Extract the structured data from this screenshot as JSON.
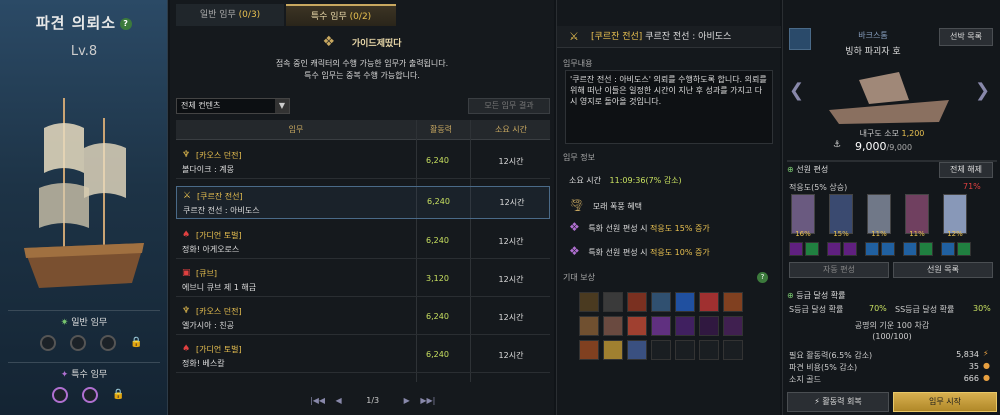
{
  "left": {
    "title": "파견 의뢰소",
    "help": "?",
    "level": "Lv.8",
    "normal_mission_label": "일반 임무",
    "special_mission_label": "특수 임무"
  },
  "tabs": [
    {
      "label": "일반 임무",
      "count": "(0/3)"
    },
    {
      "label": "특수 임무",
      "count": "(0/2)"
    }
  ],
  "guide": {
    "title": "가이드제띴다",
    "line1": "접속 중인 캐릭터의 수행 가능한 임무가 출력됩니다.",
    "line2": "특수 임무는 중복 수행 가능합니다."
  },
  "filter": {
    "value": "전체 컨텐츠",
    "result_button": "모든 임무 결과"
  },
  "table": {
    "headers": {
      "mission": "임무",
      "activity": "활동력",
      "time": "소요 시간"
    },
    "rows": [
      {
        "category": "[카오스 던전]",
        "name": "볼다이크 : 계몽",
        "activity": "6,240",
        "time": "12시간"
      },
      {
        "category": "[쿠르잔 전선]",
        "name": "쿠르잔 전선 : 아비도스",
        "activity": "6,240",
        "time": "12시간"
      },
      {
        "category": "[가디언 토벌]",
        "name": "정화! 아게오로스",
        "activity": "6,240",
        "time": "12시간"
      },
      {
        "category": "[큐브]",
        "name": "에브니 큐브 제 1 해금",
        "activity": "3,120",
        "time": "12시간"
      },
      {
        "category": "[카오스 던전]",
        "name": "엘가시아 : 친공",
        "activity": "6,240",
        "time": "12시간"
      },
      {
        "category": "[가디언 토벌]",
        "name": "정화! 베스칼",
        "activity": "6,240",
        "time": "12시간"
      }
    ]
  },
  "pager": {
    "current": "1/3"
  },
  "detail": {
    "header_tag": "[쿠르잔 전선]",
    "header_name": "쿠르잔 전선 : 아비도스",
    "content_label": "임무내용",
    "content_text": "'쿠르잔 전선 : 아비도스' 의뢰를 수행하도록 합니다. 의뢰를 위해 떠난 이들은 일정한 시간이 지난 후 성과를 가지고 다시 영지로 돌아올 것입니다.",
    "info_label": "임무 정보",
    "time_label": "소요 시간",
    "time_value": "11:09:36(7% 감소)",
    "benefit1": "모래 폭풍 혜택",
    "benefit2_pre": "특화 선원 편성 시",
    "benefit2_val": "적응도 15% 증가",
    "benefit3_pre": "특화 선원 편성 시",
    "benefit3_val": "적응도 10% 증가",
    "reward_label": "기대 보상",
    "reward_help": "?"
  },
  "ship": {
    "type": "바크스톰",
    "name": "빙하 파괴자 호",
    "select_button": "선박 목록",
    "durability_label": "내구도 소모",
    "durability_value": "1,200",
    "hp_current": "9,000",
    "hp_max": "/9,000"
  },
  "crew": {
    "label": "선원 편성",
    "disband_button": "전체 해제",
    "adapt_label": "적응도(5% 상승)",
    "adapt_value": "71%",
    "members": [
      {
        "pct": "16%",
        "color": "#6a5a80"
      },
      {
        "pct": "15%",
        "color": "#3a4a70"
      },
      {
        "pct": "11%",
        "color": "#707888"
      },
      {
        "pct": "11%",
        "color": "#704060"
      },
      {
        "pct": "12%",
        "color": "#8898b8"
      }
    ],
    "auto_button": "자동 편성",
    "list_button": "선원 목록"
  },
  "grade": {
    "label": "등급 달성 확률",
    "s_label": "S등급 달성 확률",
    "s_value": "70%",
    "ss_label": "SS등급 달성 확률",
    "ss_value": "30%",
    "honor_line1": "공명의 기운 100 차감",
    "honor_line2": "(100/100)"
  },
  "cost": {
    "activity_label": "필요 활동력(6.5% 감소)",
    "activity_value": "5,834",
    "dispatch_label": "파견 비용(5% 감소)",
    "dispatch_value": "35",
    "gold_label": "소지 골드",
    "gold_value": "666"
  },
  "footer": {
    "recover_button": "활동력 회복",
    "start_button": "임무 시작"
  },
  "colors": {
    "gold": "#c8a860",
    "green": "#c8e060",
    "accent_blue": "#4a6a88"
  }
}
